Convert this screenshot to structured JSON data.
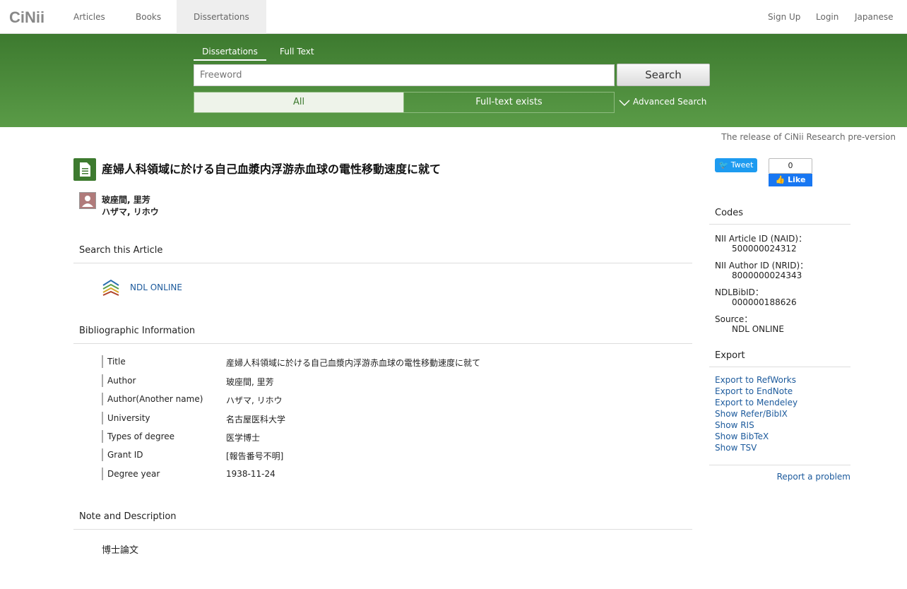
{
  "nav": {
    "tabs": [
      "Articles",
      "Books",
      "Dissertations"
    ],
    "right": [
      "Sign Up",
      "Login",
      "Japanese"
    ]
  },
  "search": {
    "tabs": [
      "Dissertations",
      "Full Text"
    ],
    "placeholder": "Freeword",
    "button": "Search",
    "toggle_all": "All",
    "toggle_full": "Full-text exists",
    "advanced": "Advanced Search"
  },
  "release_note": "The release of CiNii Research pre-version",
  "article": {
    "title": "産婦人科領域に於ける自己血漿内浮游赤血球の電性移動速度に就て",
    "author_name": "玻座間, 里芳",
    "author_kana": "ハザマ, リホウ"
  },
  "search_article": {
    "heading": "Search this Article",
    "link": "NDL ONLINE"
  },
  "bibliographic": {
    "heading": "Bibliographic Information",
    "rows": [
      {
        "label": "Title",
        "value": "産婦人科領域に於ける自己血漿内浮游赤血球の電性移動速度に就て"
      },
      {
        "label": "Author",
        "value": "玻座間, 里芳"
      },
      {
        "label": "Author(Another name)",
        "value": "ハザマ, リホウ"
      },
      {
        "label": "University",
        "value": "名古屋医科大学"
      },
      {
        "label": "Types of degree",
        "value": "医学博士"
      },
      {
        "label": "Grant ID",
        "value": "[報告番号不明]"
      },
      {
        "label": "Degree year",
        "value": "1938-11-24"
      }
    ]
  },
  "note": {
    "heading": "Note and Description",
    "text": "博士論文"
  },
  "sidebar": {
    "tweet": "Tweet",
    "like_count": "0",
    "like": "Like",
    "codes_heading": "Codes",
    "codes": [
      {
        "label": "NII Article ID (NAID)：",
        "value": "500000024312"
      },
      {
        "label": "NII Author ID (NRID)：",
        "value": "8000000024343"
      },
      {
        "label": "NDLBibID：",
        "value": "000000188626"
      },
      {
        "label": "Source：",
        "value": "NDL ONLINE"
      }
    ],
    "export_heading": "Export",
    "exports": [
      "Export to RefWorks",
      "Export to EndNote",
      "Export to Mendeley",
      "Show Refer/BibIX",
      "Show RIS",
      "Show BibTeX",
      "Show TSV"
    ],
    "report": "Report a problem"
  },
  "colors": {
    "band": "#4a8a3a",
    "link": "#1c5a9c"
  }
}
